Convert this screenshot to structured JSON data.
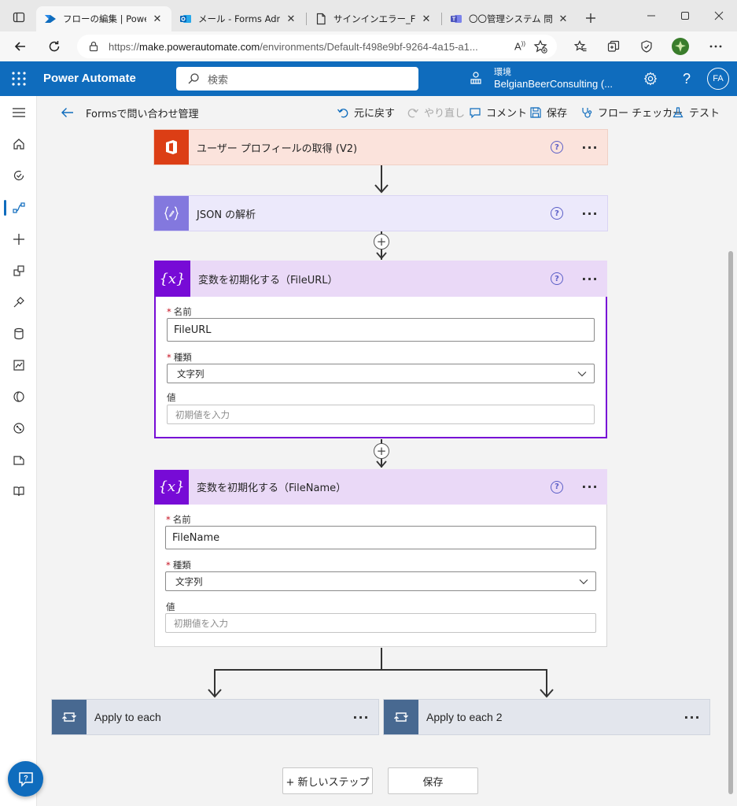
{
  "browser": {
    "tabs": [
      {
        "title": "フローの編集 | Power Aut",
        "icon": "power-automate-icon",
        "active": true
      },
      {
        "title": "メール - Forms Admin",
        "icon": "outlook-icon",
        "active": false
      },
      {
        "title": "サインインエラー_Forms",
        "icon": "document-icon",
        "active": false
      },
      {
        "title": "〇〇管理システム 問合",
        "icon": "teams-icon",
        "active": false
      }
    ],
    "url_prefix": "https://",
    "url_host": "make.powerautomate.com",
    "url_path": "/environments/Default-f498e9bf-9264-4a15-a1...",
    "read_aloud_label": "Aͅ"
  },
  "header": {
    "app_title": "Power Automate",
    "search_placeholder": "検索",
    "env_label": "環境",
    "env_name": "BelgianBeerConsulting (...",
    "avatar_initials": "FA"
  },
  "commandbar": {
    "flow_name": "Formsで問い合わせ管理",
    "undo": "元に戻す",
    "redo": "やり直し",
    "comment": "コメント",
    "save": "保存",
    "checker": "フロー チェッカー",
    "test": "テスト"
  },
  "steps": {
    "profile": {
      "title": "ユーザー プロフィールの取得 (V2)"
    },
    "json": {
      "title": "JSON の解析"
    },
    "var1": {
      "title": "変数を初期化する（FileURL）",
      "name_label": "名前",
      "name_value": "FileURL",
      "type_label": "種類",
      "type_value": "文字列",
      "value_label": "値",
      "value_placeholder": "初期値を入力"
    },
    "var2": {
      "title": "変数を初期化する（FileName）",
      "name_label": "名前",
      "name_value": "FileName",
      "type_label": "種類",
      "type_value": "文字列",
      "value_label": "値",
      "value_placeholder": "初期値を入力"
    },
    "apply1": {
      "title": "Apply to each"
    },
    "apply2": {
      "title": "Apply to each 2"
    },
    "required_mark": "*",
    "more": "···",
    "help": "?"
  },
  "bottom": {
    "new_step": "+ 新しいステップ",
    "save": "保存"
  },
  "colors": {
    "header_blue": "#0f6cbd",
    "office_orange": "#dc3e15",
    "profile_bg": "#fbe3dc",
    "json_purple": "#8378de",
    "json_bg": "#ece9fb",
    "variable_purple": "#770bd6",
    "variable_bg": "#ead9f7",
    "loop_slate": "#486991",
    "loop_bg": "#e3e6ed"
  }
}
